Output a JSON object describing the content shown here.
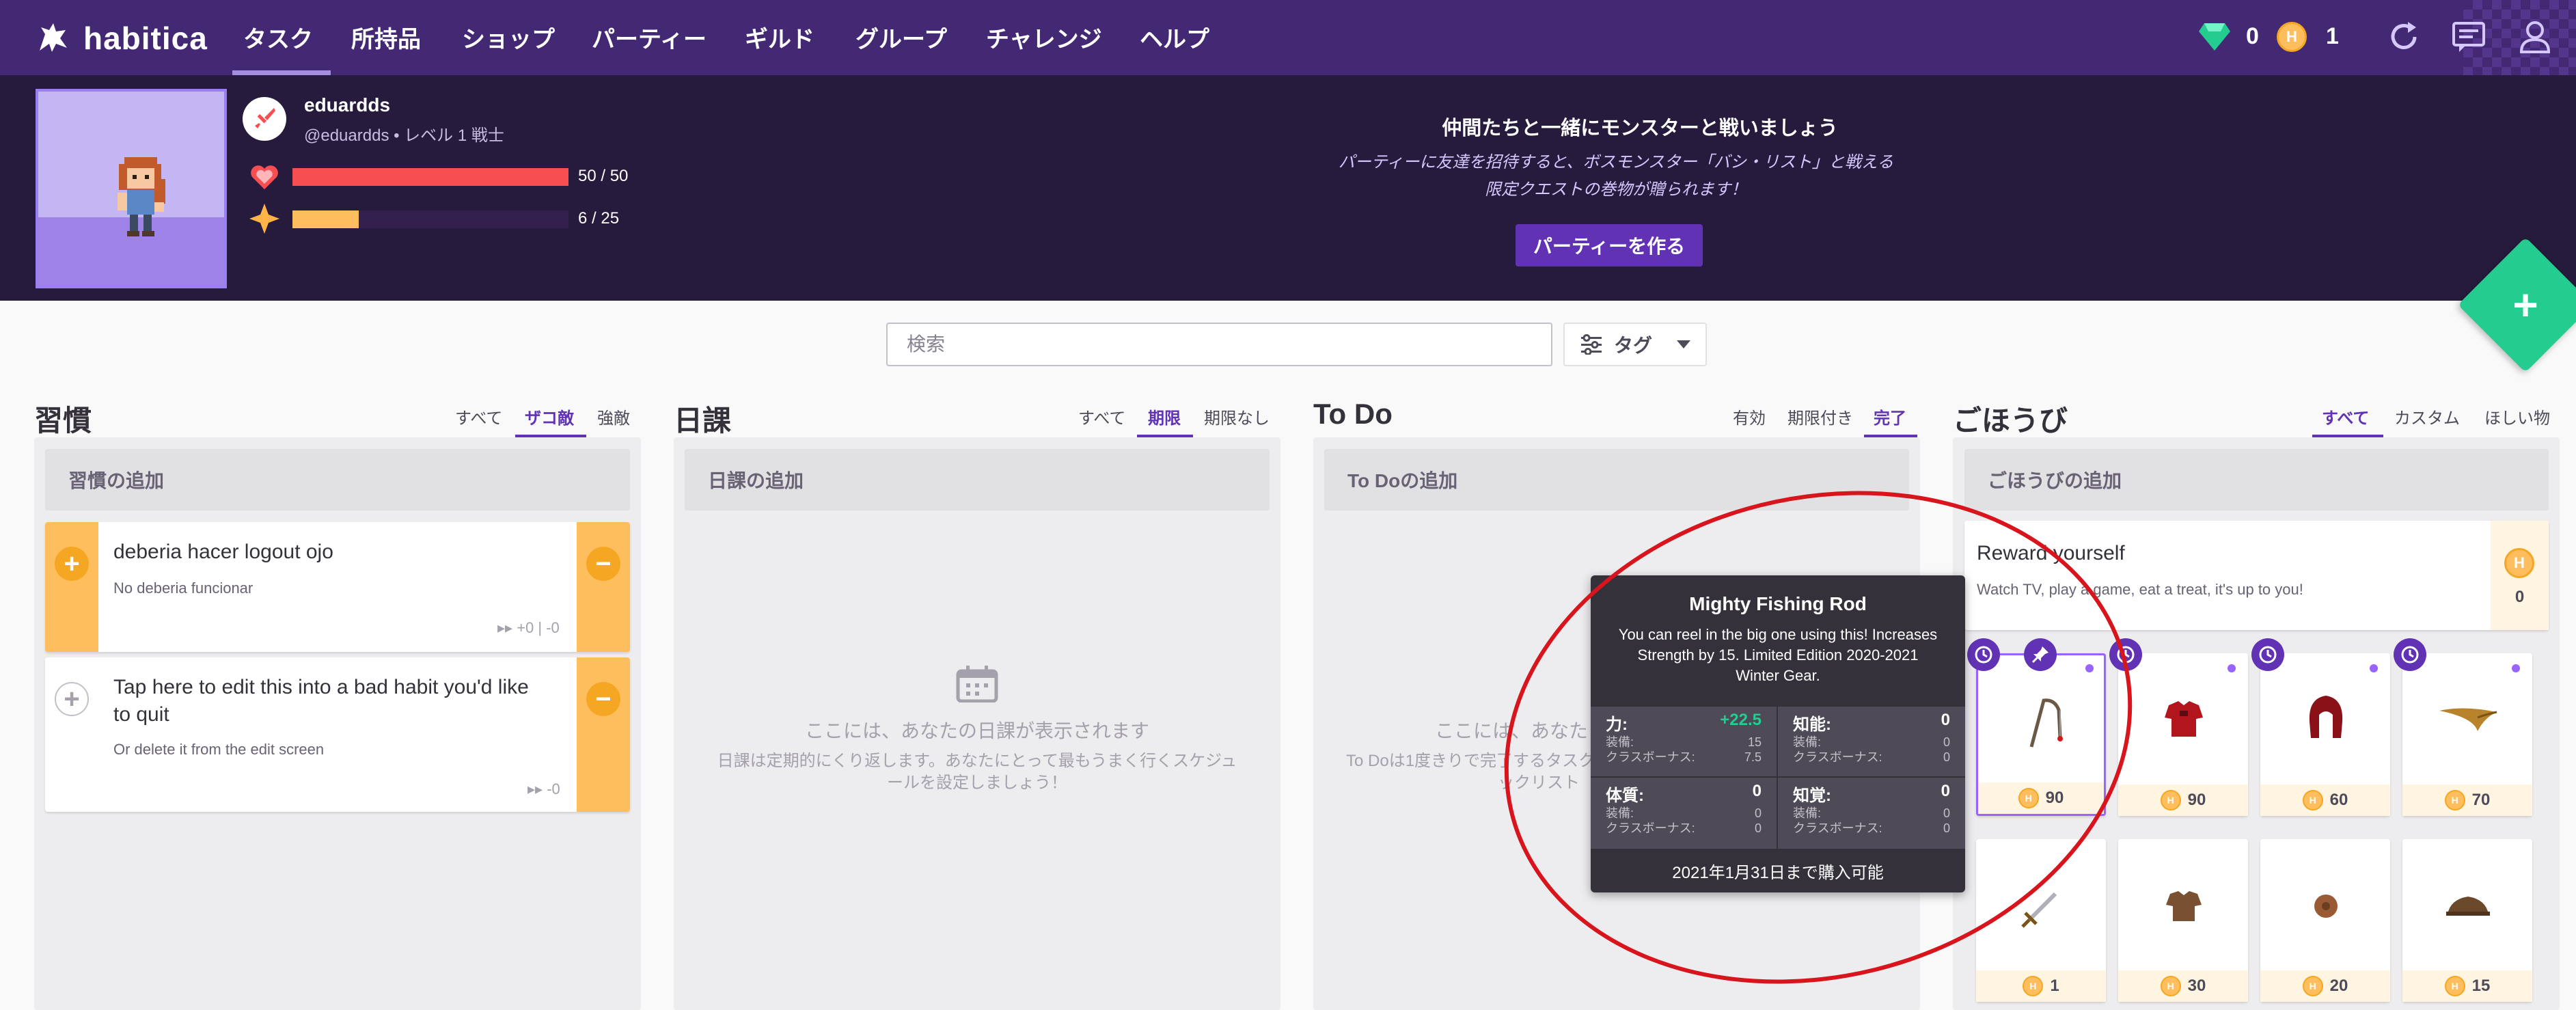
{
  "nav": {
    "logo": "habitica",
    "items": [
      "タスク",
      "所持品",
      "ショップ",
      "パーティー",
      "ギルド",
      "グループ",
      "チャレンジ",
      "ヘルプ"
    ],
    "gems": "0",
    "gold": "1"
  },
  "user": {
    "name": "eduardds",
    "line": "@eduardds • レベル 1 戦士",
    "hp": "50 / 50",
    "hp_fraction": 1.0,
    "xp": "6 / 25",
    "xp_fraction": 0.24
  },
  "party": {
    "title": "仲間たちと一緒にモンスターと戦いましょう",
    "desc1": "パーティーに友達を招待すると、ボスモンスター「バシ・リスト」と戦える",
    "desc2": "限定クエストの巻物が贈られます！",
    "button": "パーティーを作る"
  },
  "search": {
    "placeholder": "検索",
    "tags": "タグ"
  },
  "habits": {
    "title": "習慣",
    "filters": [
      "すべて",
      "ザコ敵",
      "強敵"
    ],
    "add": "習慣の追加",
    "items": [
      {
        "title": "deberia hacer logout ojo",
        "notes": "No deberia funcionar",
        "meta": "+0 | -0"
      },
      {
        "title": "Tap here to edit this into a bad habit you'd like to quit",
        "notes": "Or delete it from the edit screen",
        "meta": "-0"
      }
    ]
  },
  "dailies": {
    "title": "日課",
    "filters": [
      "すべて",
      "期限",
      "期限なし"
    ],
    "add": "日課の追加",
    "empty_title": "ここには、あなたの日課が表示されます",
    "empty_desc1": "日課は定期的にくり返します。あなたにとって最もうまく行くスケジュ",
    "empty_desc2": "ールを設定しましょう！"
  },
  "todos": {
    "title": "To Do",
    "filters": [
      "有効",
      "期限付き",
      "完了"
    ],
    "add": "To Doの追加",
    "empty_title": "ここには、あなた",
    "empty_desc1": "To Doは1度きりで完了するタスク",
    "empty_desc2": "ックリスト"
  },
  "rewards": {
    "title": "ごほうび",
    "filters": [
      "すべて",
      "カスタム",
      "ほしい物"
    ],
    "add": "ごほうびの追加",
    "custom": {
      "title": "Reward yourself",
      "notes": "Watch TV, play a game, eat a treat, it's up to you!",
      "price": "0"
    },
    "items": [
      {
        "price": "90",
        "icon": "fishing-rod"
      },
      {
        "price": "90",
        "icon": "red-armor"
      },
      {
        "price": "60",
        "icon": "red-hood"
      },
      {
        "price": "70",
        "icon": "horn"
      },
      {
        "price": "1",
        "icon": "sword"
      },
      {
        "price": "30",
        "icon": "leather-armor"
      },
      {
        "price": "20",
        "icon": "round-shield"
      },
      {
        "price": "15",
        "icon": "leather-helm"
      }
    ]
  },
  "tooltip": {
    "title": "Mighty Fishing Rod",
    "desc": "You can reel in the big one using this! Increases Strength by 15. Limited Edition 2020-2021 Winter Gear.",
    "str_label": "力:",
    "str_value": "+22.5",
    "int_label": "知能:",
    "int_value": "0",
    "con_label": "体質:",
    "con_value": "0",
    "per_label": "知覚:",
    "per_value": "0",
    "equip_label": "装備:",
    "class_label": "クラスボーナス:",
    "str_equip": "15",
    "str_class": "7.5",
    "int_equip": "0",
    "int_class": "0",
    "con_equip": "0",
    "con_class": "0",
    "per_equip": "0",
    "per_class": "0",
    "footer": "2021年1月31日まで購入可能"
  },
  "colors": {
    "purple": "#432874",
    "header": "#271b3d",
    "health": "#f74e52",
    "experience": "#ffbe5d",
    "fab": "#24cc8f",
    "annotation": "#d8141c"
  }
}
